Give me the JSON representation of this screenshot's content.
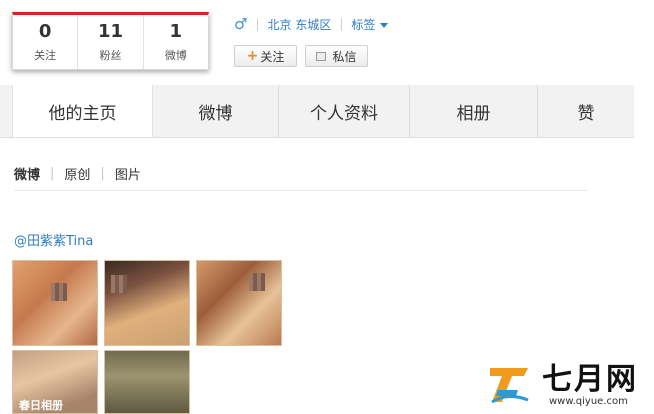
{
  "profile": {
    "stats": [
      {
        "value": "0",
        "label": "关注"
      },
      {
        "value": "11",
        "label": "粉丝"
      },
      {
        "value": "1",
        "label": "微博"
      }
    ],
    "gender_symbol": "♂",
    "location": "北京 东城区",
    "tags_label": "标签",
    "follow_label": "关注",
    "message_label": "私信"
  },
  "tabs": [
    "他的主页",
    "微博",
    "个人资料",
    "相册",
    "赞"
  ],
  "subnav": [
    "微博",
    "原创",
    "图片"
  ],
  "post": {
    "author": "@田紫紫Tina",
    "photo_caption": "春日相册"
  },
  "watermark": {
    "brand": "七月网",
    "url": "www.qiyue.com"
  },
  "colors": {
    "accent_red": "#e02020",
    "link_blue": "#2f7dc3",
    "plus_orange": "#f08a1c"
  }
}
